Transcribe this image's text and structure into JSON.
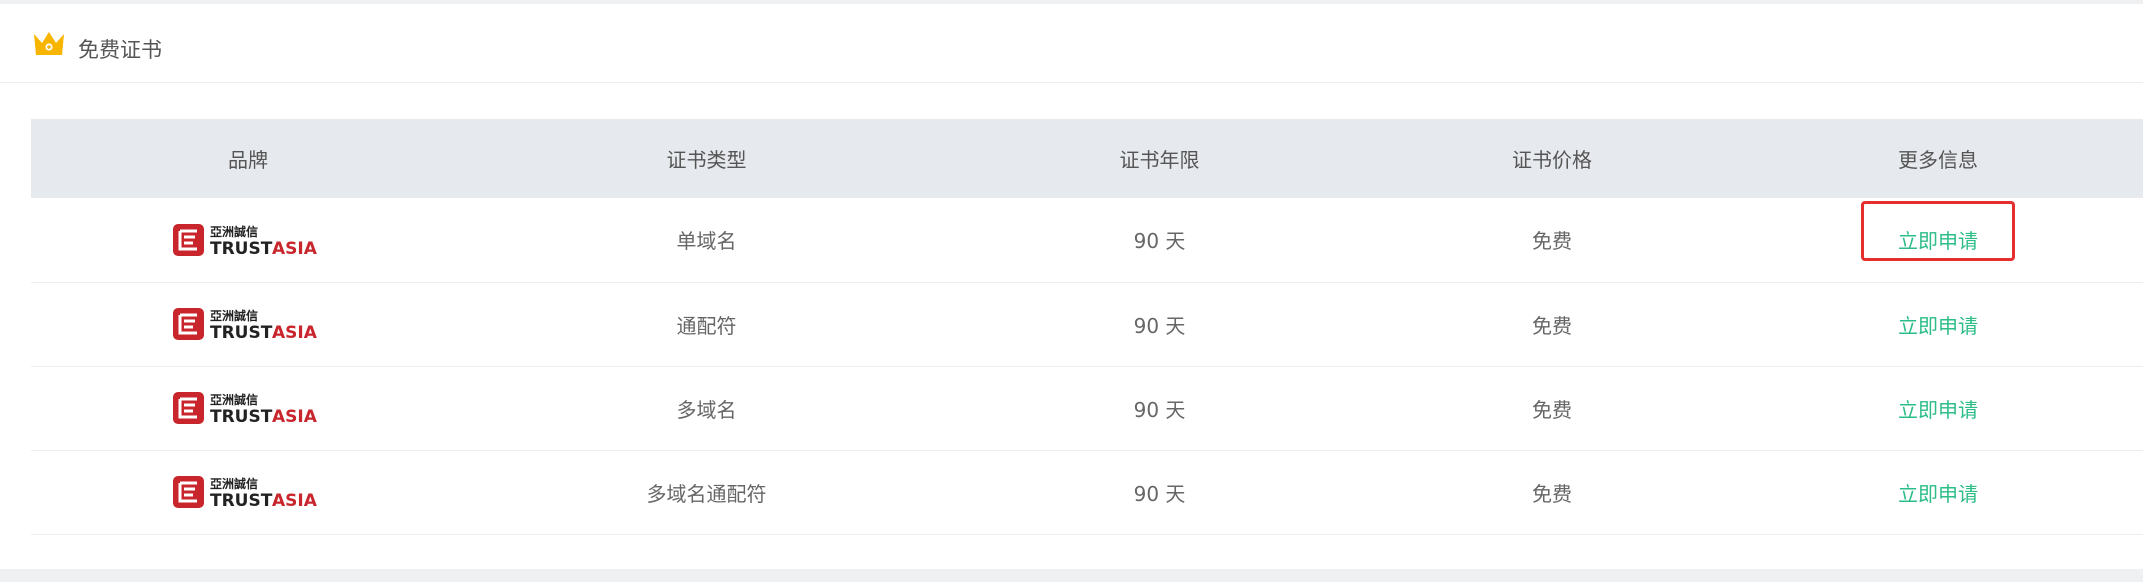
{
  "card": {
    "title": "免费证书",
    "icon": "crown-icon",
    "accent_color": "#f8b500"
  },
  "table": {
    "headers": [
      "品牌",
      "证书类型",
      "证书年限",
      "证书价格",
      "更多信息"
    ],
    "rows": [
      {
        "brand": "TrustAsia",
        "brand_cn": "亞洲誠信",
        "type": "单域名",
        "duration": "90 天",
        "price": "免费",
        "action": "立即申请"
      },
      {
        "brand": "TrustAsia",
        "brand_cn": "亞洲誠信",
        "type": "通配符",
        "duration": "90 天",
        "price": "免费",
        "action": "立即申请"
      },
      {
        "brand": "TrustAsia",
        "brand_cn": "亞洲誠信",
        "type": "多域名",
        "duration": "90 天",
        "price": "免费",
        "action": "立即申请"
      },
      {
        "brand": "TrustAsia",
        "brand_cn": "亞洲誠信",
        "type": "多域名通配符",
        "duration": "90 天",
        "price": "免费",
        "action": "立即申请"
      }
    ]
  },
  "colors": {
    "link": "#2dbd87",
    "header_bg": "#e6e9ed",
    "brand_red": "#c9252c",
    "highlight": "#e52e2e"
  }
}
